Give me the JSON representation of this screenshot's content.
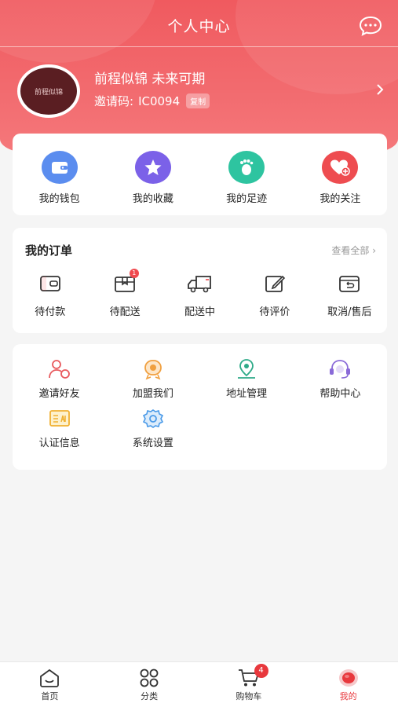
{
  "header": {
    "title": "个人中心",
    "message_icon": "chat-bubble-icon"
  },
  "profile": {
    "avatar_text": "前程似锦",
    "nickname": "前程似锦 未来可期",
    "invite_label": "邀请码:",
    "invite_code": "IC0094",
    "copy_label": "复制"
  },
  "quick_actions": [
    {
      "label": "我的钱包",
      "icon": "wallet-icon",
      "color": "#5b8def"
    },
    {
      "label": "我的收藏",
      "icon": "star-icon",
      "color": "#7b61e8"
    },
    {
      "label": "我的足迹",
      "icon": "footprint-icon",
      "color": "#2ec4a0"
    },
    {
      "label": "我的关注",
      "icon": "heart-plus-icon",
      "color": "#ee4c50"
    }
  ],
  "orders": {
    "title": "我的订单",
    "view_all": "查看全部",
    "items": [
      {
        "label": "待付款",
        "icon": "wallet-outline-icon",
        "badge": ""
      },
      {
        "label": "待配送",
        "icon": "box-icon",
        "badge": "1"
      },
      {
        "label": "配送中",
        "icon": "truck-icon",
        "badge": ""
      },
      {
        "label": "待评价",
        "icon": "edit-icon",
        "badge": ""
      },
      {
        "label": "取消/售后",
        "icon": "return-box-icon",
        "badge": ""
      }
    ]
  },
  "services": [
    {
      "label": "邀请好友",
      "icon": "invite-users-icon",
      "color": "#e85a5e"
    },
    {
      "label": "加盟我们",
      "icon": "medal-icon",
      "color": "#f0a040"
    },
    {
      "label": "地址管理",
      "icon": "location-pin-icon",
      "color": "#2eaa88"
    },
    {
      "label": "帮助中心",
      "icon": "headset-icon",
      "color": "#8a6ad8"
    },
    {
      "label": "认证信息",
      "icon": "id-card-icon",
      "color": "#f0b030"
    },
    {
      "label": "系统设置",
      "icon": "gear-icon",
      "color": "#4a9ae8"
    }
  ],
  "tabbar": [
    {
      "label": "首页",
      "icon": "home-icon",
      "active": false
    },
    {
      "label": "分类",
      "icon": "grid-icon",
      "active": false
    },
    {
      "label": "购物车",
      "icon": "cart-icon",
      "active": false,
      "badge": "4"
    },
    {
      "label": "我的",
      "icon": "profile-icon",
      "active": true
    }
  ],
  "colors": {
    "brand": "#f05a5f",
    "active_tab": "#e8383d"
  }
}
